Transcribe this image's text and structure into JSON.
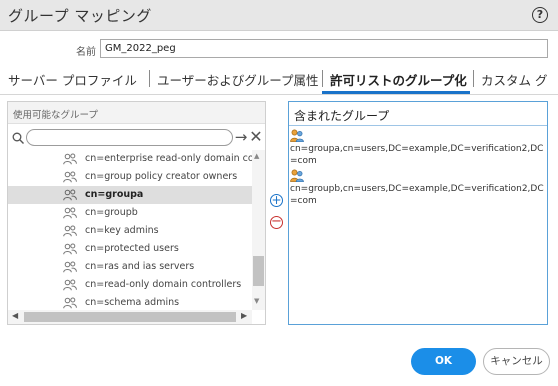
{
  "dialog": {
    "title": "グループ マッピング",
    "help_icon": "help-icon"
  },
  "name_field": {
    "label": "名前",
    "value": "GM_2022_peg"
  },
  "tabs": [
    {
      "label": "サーバー プロファイル",
      "active": false
    },
    {
      "label": "ユーザーおよびグループ属性",
      "active": false
    },
    {
      "label": "許可リストのグループ化",
      "active": true
    },
    {
      "label": "カスタム グ",
      "active": false
    }
  ],
  "available": {
    "header": "使用可能なグループ",
    "search_value": "",
    "items": [
      {
        "label": "cn=enterprise read-only domain contro",
        "selected": false
      },
      {
        "label": "cn=group policy creator owners",
        "selected": false
      },
      {
        "label": "cn=groupa",
        "selected": true
      },
      {
        "label": "cn=groupb",
        "selected": false
      },
      {
        "label": "cn=key admins",
        "selected": false
      },
      {
        "label": "cn=protected users",
        "selected": false
      },
      {
        "label": "cn=ras and ias servers",
        "selected": false
      },
      {
        "label": "cn=read-only domain controllers",
        "selected": false
      },
      {
        "label": "cn=schema admins",
        "selected": false
      }
    ]
  },
  "included": {
    "header": "含まれたグループ",
    "items": [
      {
        "label": "cn=groupa,cn=users,DC=example,DC=verification2,DC=com"
      },
      {
        "label": "cn=groupb,cn=users,DC=example,DC=verification2,DC=com"
      }
    ]
  },
  "buttons": {
    "ok": "OK",
    "cancel": "キャンセル"
  },
  "colors": {
    "accent": "#1a73c9",
    "ok_button": "#1b8ee8",
    "remove": "#c8312f",
    "selected_row": "#dedede"
  }
}
